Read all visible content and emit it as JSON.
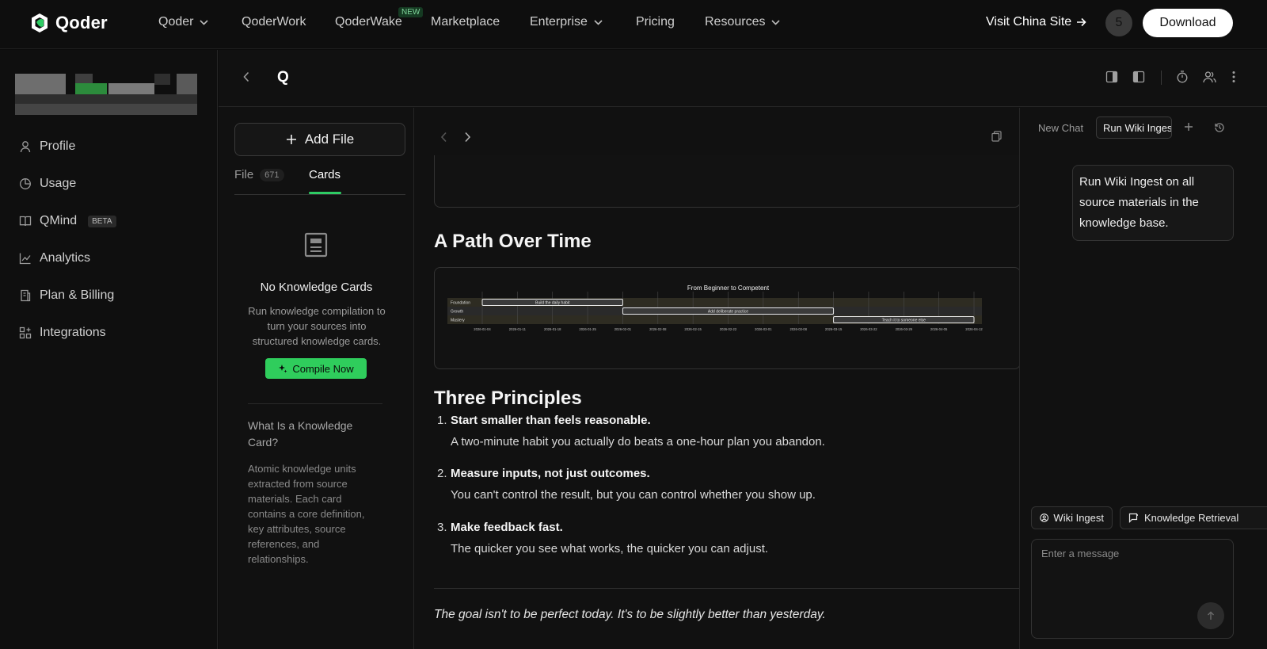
{
  "brand": {
    "name": "Qoder"
  },
  "topnav": {
    "items": [
      {
        "label": "Qoder",
        "dropdown": true
      },
      {
        "label": "QoderWork",
        "dropdown": false
      },
      {
        "label": "QoderWake",
        "dropdown": false,
        "badge": "NEW"
      },
      {
        "label": "Marketplace",
        "dropdown": false
      },
      {
        "label": "Enterprise",
        "dropdown": true
      },
      {
        "label": "Pricing",
        "dropdown": false
      },
      {
        "label": "Resources",
        "dropdown": true
      }
    ],
    "visit_label": "Visit China Site",
    "avatar_initial": "5",
    "download_label": "Download"
  },
  "sidebar": {
    "items": [
      {
        "label": "Profile",
        "icon": "user-icon"
      },
      {
        "label": "Usage",
        "icon": "pie-chart-icon"
      },
      {
        "label": "QMind",
        "icon": "book-icon",
        "badge": "BETA"
      },
      {
        "label": "Analytics",
        "icon": "line-chart-icon"
      },
      {
        "label": "Plan & Billing",
        "icon": "receipt-icon"
      },
      {
        "label": "Integrations",
        "icon": "grid-plus-icon"
      }
    ]
  },
  "workspace": {
    "title": "Q"
  },
  "cards_panel": {
    "add_file_label": "Add File",
    "tabs": [
      {
        "label": "File",
        "count": "671"
      },
      {
        "label": "Cards"
      }
    ],
    "empty_title": "No Knowledge Cards",
    "empty_desc": "Run knowledge compilation to turn your sources into structured knowledge cards.",
    "compile_label": "Compile Now",
    "what_title": "What Is a Knowledge Card?",
    "what_desc": "Atomic knowledge units extracted from source materials. Each card contains a core definition, key attributes, source references, and relationships."
  },
  "document": {
    "section1_title": "A Path Over Time",
    "section2_title": "Three Principles",
    "principles": [
      {
        "num": "1.",
        "title": "Start smaller than feels reasonable.",
        "desc": "A two-minute habit you actually do beats a one-hour plan you abandon."
      },
      {
        "num": "2.",
        "title": "Measure inputs, not just outcomes.",
        "desc": "You can't control the result, but you can control whether you show up."
      },
      {
        "num": "3.",
        "title": "Make feedback fast.",
        "desc": "The quicker you see what works, the quicker you can adjust."
      }
    ],
    "quote": "The goal isn't to be perfect today. It's to be slightly better than yesterday."
  },
  "chart_data": {
    "type": "gantt",
    "title": "From Beginner to Competent",
    "rows": [
      "Foundation",
      "Growth",
      "Mastery"
    ],
    "tasks": [
      {
        "row": "Foundation",
        "label": "Build the daily habit",
        "start": "2026-01-04",
        "end": "2026-02-01"
      },
      {
        "row": "Growth",
        "label": "Add deliberate practice",
        "start": "2026-02-01",
        "end": "2026-03-15"
      },
      {
        "row": "Mastery",
        "label": "Teach it to someone else",
        "start": "2026-03-15",
        "end": "2026-04-12"
      }
    ],
    "x_ticks": [
      "2026-01-04",
      "2026-01-11",
      "2026-01-18",
      "2026-01-25",
      "2026-02-01",
      "2026-02-08",
      "2026-02-15",
      "2026-02-22",
      "2026-03-01",
      "2026-03-08",
      "2026-03-15",
      "2026-03-22",
      "2026-03-29",
      "2026-04-05",
      "2026-04-12"
    ],
    "x_range": [
      "2026-01-04",
      "2026-04-12"
    ],
    "grid": true
  },
  "chat": {
    "tab_new": "New Chat",
    "tab_active": "Run Wiki Ingest",
    "message": "Run Wiki Ingest on all source materials in the knowledge base.",
    "chips": [
      {
        "label": "Wiki Ingest",
        "icon": "person-circle-icon"
      },
      {
        "label": "Knowledge Retrieval",
        "icon": "chat-search-icon"
      }
    ],
    "input_placeholder": "Enter a message"
  }
}
